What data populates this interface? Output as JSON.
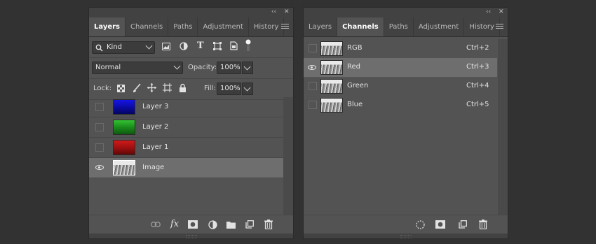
{
  "layers_panel": {
    "tabs": [
      "Layers",
      "Channels",
      "Paths",
      "Adjustment",
      "History"
    ],
    "active_tab": "Layers",
    "filter": {
      "label": "Kind"
    },
    "blend_mode": "Normal",
    "opacity": {
      "label": "Opacity:",
      "value": "100%"
    },
    "lock": {
      "label": "Lock:"
    },
    "fill": {
      "label": "Fill:",
      "value": "100%"
    },
    "layers": [
      {
        "name": "Layer 3",
        "visible": false,
        "thumb_color": "#0a0acc"
      },
      {
        "name": "Layer 2",
        "visible": false,
        "thumb_color": "#1f9f1f"
      },
      {
        "name": "Layer 1",
        "visible": false,
        "thumb_color": "#b31212"
      },
      {
        "name": "Image",
        "visible": true,
        "thumb_color": "#a8a8a8",
        "selected": true
      }
    ],
    "footer_icons": [
      "link-icon",
      "fx-icon",
      "mask-icon",
      "adjustment-icon",
      "folder-icon",
      "new-layer-icon",
      "trash-icon"
    ],
    "footer_fx_label": "fx"
  },
  "channels_panel": {
    "tabs": [
      "Layers",
      "Channels",
      "Paths",
      "Adjustment",
      "History"
    ],
    "active_tab": "Channels",
    "channels": [
      {
        "name": "RGB",
        "shortcut": "Ctrl+2",
        "visible": false
      },
      {
        "name": "Red",
        "shortcut": "Ctrl+3",
        "visible": true,
        "selected": true
      },
      {
        "name": "Green",
        "shortcut": "Ctrl+4",
        "visible": false
      },
      {
        "name": "Blue",
        "shortcut": "Ctrl+5",
        "visible": false
      }
    ],
    "footer_icons": [
      "selection-icon",
      "mask-icon",
      "new-channel-icon",
      "trash-icon"
    ]
  },
  "colors": {
    "panel_bg": "#535353",
    "tab_bar_bg": "#424242",
    "selected_row": "#6e6e6e",
    "app_bg": "#323232"
  }
}
